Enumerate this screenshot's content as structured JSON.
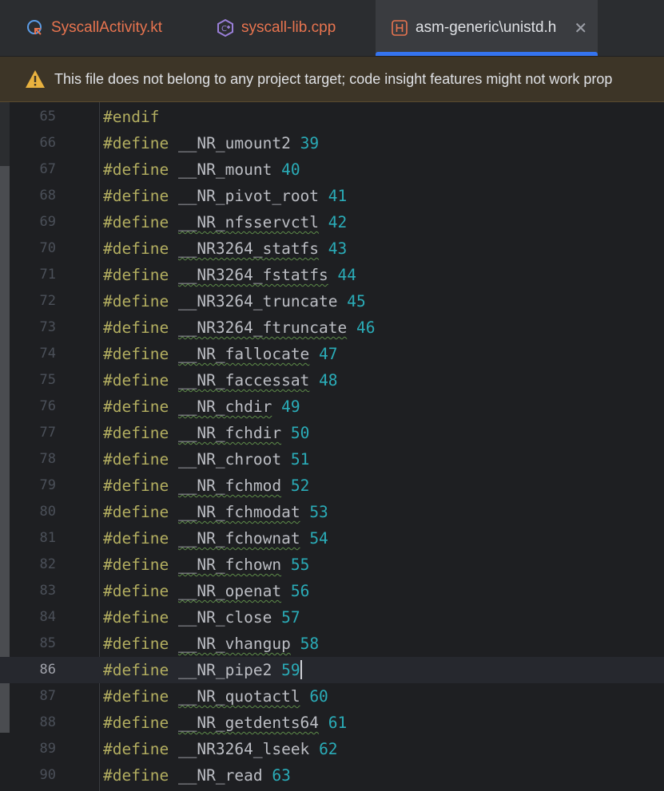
{
  "tabs": [
    {
      "label": "SyscallActivity.kt",
      "icon": "kotlin-class-icon",
      "active": false
    },
    {
      "label": "syscall-lib.cpp",
      "icon": "cpp-file-icon",
      "active": false
    },
    {
      "label": "asm-generic\\unistd.h",
      "icon": "header-file-icon",
      "active": true
    }
  ],
  "banner": {
    "message": "This file does not belong to any project target; code insight features might not work prop"
  },
  "colors": {
    "directive": "#b3ae60",
    "identifier": "#bcbec4",
    "number": "#2aacb8",
    "accent": "#3574f0"
  },
  "current_line": "86",
  "lines": [
    {
      "num": "65",
      "directive": "#endif",
      "name": "",
      "value": ""
    },
    {
      "num": "66",
      "directive": "#define",
      "name": "__NR_umount2",
      "value": "39"
    },
    {
      "num": "67",
      "directive": "#define",
      "name": "__NR_mount",
      "value": "40"
    },
    {
      "num": "68",
      "directive": "#define",
      "name": "__NR_pivot_root",
      "value": "41"
    },
    {
      "num": "69",
      "directive": "#define",
      "name": "__NR_nfsservctl",
      "value": "42"
    },
    {
      "num": "70",
      "directive": "#define",
      "name": "__NR3264_statfs",
      "value": "43"
    },
    {
      "num": "71",
      "directive": "#define",
      "name": "__NR3264_fstatfs",
      "value": "44"
    },
    {
      "num": "72",
      "directive": "#define",
      "name": "__NR3264_truncate",
      "value": "45"
    },
    {
      "num": "73",
      "directive": "#define",
      "name": "__NR3264_ftruncate",
      "value": "46"
    },
    {
      "num": "74",
      "directive": "#define",
      "name": "__NR_fallocate",
      "value": "47"
    },
    {
      "num": "75",
      "directive": "#define",
      "name": "__NR_faccessat",
      "value": "48"
    },
    {
      "num": "76",
      "directive": "#define",
      "name": "__NR_chdir",
      "value": "49"
    },
    {
      "num": "77",
      "directive": "#define",
      "name": "__NR_fchdir",
      "value": "50"
    },
    {
      "num": "78",
      "directive": "#define",
      "name": "__NR_chroot",
      "value": "51"
    },
    {
      "num": "79",
      "directive": "#define",
      "name": "__NR_fchmod",
      "value": "52"
    },
    {
      "num": "80",
      "directive": "#define",
      "name": "__NR_fchmodat",
      "value": "53"
    },
    {
      "num": "81",
      "directive": "#define",
      "name": "__NR_fchownat",
      "value": "54"
    },
    {
      "num": "82",
      "directive": "#define",
      "name": "__NR_fchown",
      "value": "55"
    },
    {
      "num": "83",
      "directive": "#define",
      "name": "__NR_openat",
      "value": "56"
    },
    {
      "num": "84",
      "directive": "#define",
      "name": "__NR_close",
      "value": "57"
    },
    {
      "num": "85",
      "directive": "#define",
      "name": "__NR_vhangup",
      "value": "58"
    },
    {
      "num": "86",
      "directive": "#define",
      "name": "__NR_pipe2",
      "value": "59"
    },
    {
      "num": "87",
      "directive": "#define",
      "name": "__NR_quotactl",
      "value": "60"
    },
    {
      "num": "88",
      "directive": "#define",
      "name": "__NR_getdents64",
      "value": "61"
    },
    {
      "num": "89",
      "directive": "#define",
      "name": "__NR3264_lseek",
      "value": "62"
    },
    {
      "num": "90",
      "directive": "#define",
      "name": "__NR_read",
      "value": "63"
    }
  ]
}
